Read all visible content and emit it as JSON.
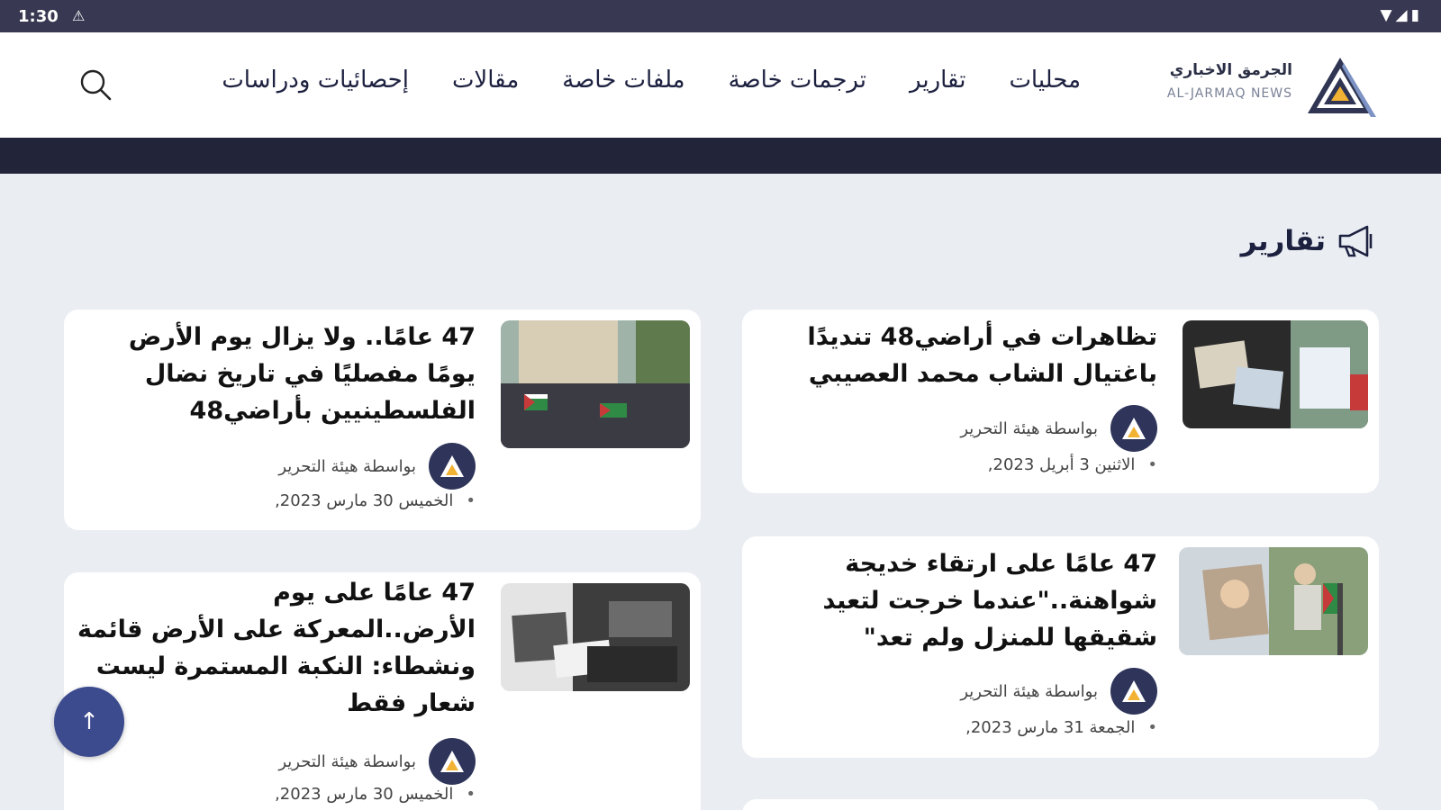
{
  "status_bar": {
    "time": "1:30",
    "notification_icon": "warning-triangle-icon",
    "system_icons": [
      "wifi-icon",
      "signal-icon",
      "battery-icon"
    ]
  },
  "header": {
    "brand_ar": "الجرمق الاخباري",
    "brand_en": "AL-JARMAQ NEWS",
    "nav": [
      "محليات",
      "تقارير",
      "ترجمات خاصة",
      "ملفات خاصة",
      "مقالات",
      "إحصائيات ودراسات"
    ],
    "search_icon": "search-icon"
  },
  "section": {
    "title": "تقارير",
    "icon": "megaphone-icon"
  },
  "articles": [
    {
      "title_lines": [
        "تظاهرات في أراضي48 تنديدًا",
        "باغتيال الشاب محمد العصيبي"
      ],
      "author": "بواسطة هيئة التحرير",
      "date": "الاثنين 3 أبريل 2023,"
    },
    {
      "title_lines": [
        "47 عامًا.. ولا يزال يوم الأرض",
        "يومًا مفصليًا في تاريخ نضال",
        "الفلسطينيين بأراضي48"
      ],
      "author": "بواسطة هيئة التحرير",
      "date": "الخميس 30 مارس 2023,"
    },
    {
      "title_lines": [
        "47 عامًا على ارتقاء خديجة",
        "شواهنة..\"عندما خرجت لتعيد",
        "شقيقها للمنزل ولم تعد\""
      ],
      "author": "بواسطة هيئة التحرير",
      "date": "الجمعة 31 مارس 2023,"
    },
    {
      "title_lines": [
        "47  عامًا على يوم",
        "الأرض..المعركة على الأرض قائمة",
        "ونشطاء: النكبة المستمرة ليست",
        "شعار فقط"
      ],
      "author": "بواسطة هيئة التحرير",
      "date": "الخميس 30 مارس 2023,"
    }
  ],
  "scroll_top_icon": "arrow-up-icon",
  "colors": {
    "status_bar": "#383852",
    "dark_bar": "#22243a",
    "background": "#eaeef3",
    "accent": "#3c4a8e"
  }
}
